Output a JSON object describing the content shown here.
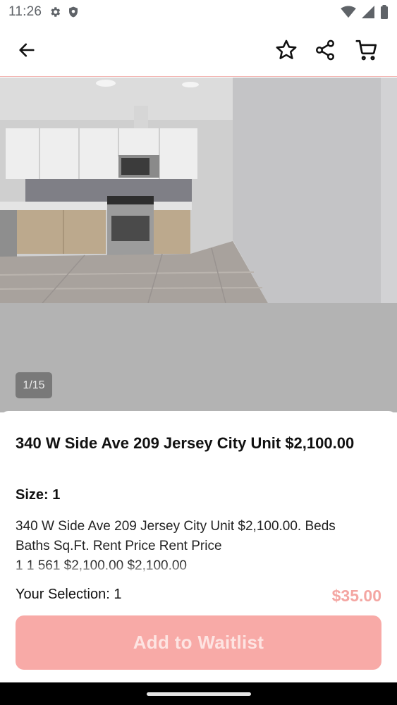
{
  "status_bar": {
    "time": "11:26"
  },
  "gallery": {
    "counter": "1/15"
  },
  "listing": {
    "title": "340 W Side Ave 209 Jersey City Unit $2,100.00",
    "size_label": "Size:",
    "size_value": "1",
    "description_line1": "340 W Side Ave 209 Jersey City Unit $2,100.00. Beds",
    "description_line2": "Baths  Sq.Ft. Rent Price Rent Price",
    "description_line3": "1  1  561 $2,100.00 $2,100.00"
  },
  "footer": {
    "selection_label": "Your Selection: 1",
    "price": "$35.00",
    "button_label": "Add to Waitlist"
  },
  "colors": {
    "accent": "#f8aaa7",
    "price": "#f4a6a2",
    "divider": "#f3b8b5"
  },
  "icons": [
    "settings-icon",
    "shield-icon",
    "wifi-icon",
    "signal-icon",
    "battery-icon",
    "back-arrow-icon",
    "star-icon",
    "share-icon",
    "cart-icon"
  ]
}
